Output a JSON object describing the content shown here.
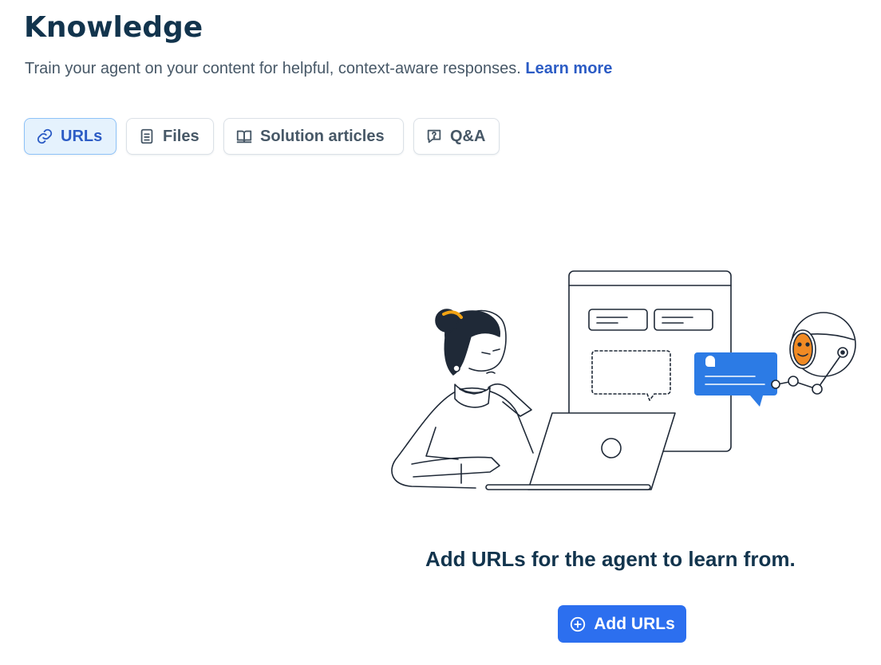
{
  "header": {
    "title": "Knowledge",
    "subtitle": "Train your agent on your content for helpful, context-aware responses.",
    "learn_more": "Learn more"
  },
  "tabs": [
    {
      "label": "URLs",
      "icon": "link-icon",
      "active": true
    },
    {
      "label": "Files",
      "icon": "file-icon",
      "active": false
    },
    {
      "label": "Solution articles",
      "icon": "book-icon",
      "active": false
    },
    {
      "label": "Q&A",
      "icon": "question-bubble-icon",
      "active": false
    }
  ],
  "empty_state": {
    "illustration": "person-laptop-robot-illustration",
    "message": "Add URLs for the agent to learn from.",
    "button_label": "Add URLs",
    "button_icon": "plus-circle-icon"
  },
  "colors": {
    "title": "#12344d",
    "link": "#2c5cc5",
    "active_tab_bg": "#e5f2fd",
    "active_tab_border": "#8ec2f8",
    "primary_button": "#2c6fef"
  }
}
